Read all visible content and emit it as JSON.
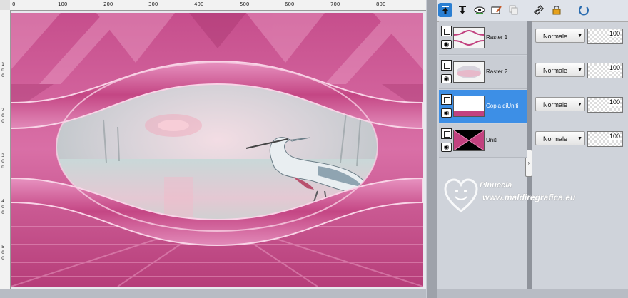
{
  "ruler": {
    "top_labels": [
      "0",
      "100",
      "200",
      "300",
      "400",
      "500",
      "600",
      "700",
      "800"
    ],
    "left_labels": [
      "1",
      "0",
      "0",
      "2",
      "0",
      "0",
      "3",
      "0",
      "0",
      "4",
      "0",
      "0",
      "5",
      "0",
      "0"
    ]
  },
  "toolbar": {
    "icons": [
      "move-layer-up-icon",
      "move-layer-down-icon",
      "visibility-icon",
      "edit-layer-icon",
      "duplicate-layer-icon",
      "link-icon",
      "lock-icon",
      "refresh-icon"
    ]
  },
  "layers": [
    {
      "name": "Raster 1",
      "blend": "Normale",
      "opacity": "100",
      "selected": false
    },
    {
      "name": "Raster 2",
      "blend": "Normale",
      "opacity": "100",
      "selected": false
    },
    {
      "name": "Copia diUniti",
      "blend": "Normale",
      "opacity": "100",
      "selected": true
    },
    {
      "name": "Uniti",
      "blend": "Normale",
      "opacity": "100",
      "selected": false
    }
  ],
  "watermark": {
    "name": "Pinuccia",
    "url": "www.maldiregrafica.eu"
  },
  "colors": {
    "selected": "#3d8fe6",
    "pink": "#c2417f"
  }
}
